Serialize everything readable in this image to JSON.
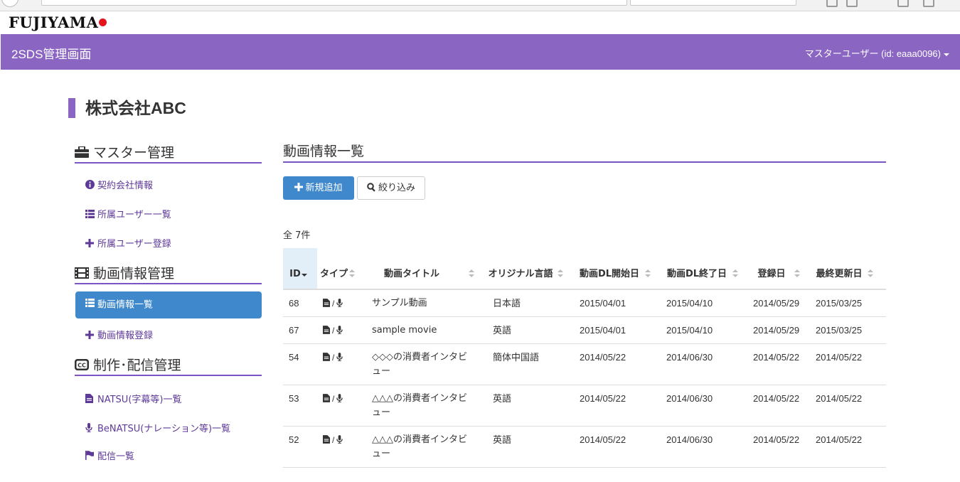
{
  "logo": {
    "text": "FUJIYAMA"
  },
  "navbar": {
    "brand": "2SDS管理画面",
    "user": "マスターユーザー (id: eaaa0096)"
  },
  "company": "株式会社ABC",
  "sidebar": {
    "master": {
      "title": "マスター管理",
      "icon": "briefcase-icon",
      "items": [
        {
          "label": "契約会社情報",
          "icon": "info-circle-icon"
        },
        {
          "label": "所属ユーザー一覧",
          "icon": "list-icon"
        },
        {
          "label": "所属ユーザー登録",
          "icon": "plus-icon"
        }
      ]
    },
    "video": {
      "title": "動画情報管理",
      "icon": "film-icon",
      "items": [
        {
          "label": "動画情報一覧",
          "icon": "list-icon",
          "active": true
        },
        {
          "label": "動画情報登録",
          "icon": "plus-icon"
        }
      ]
    },
    "production": {
      "title": "制作･配信管理",
      "icon": "cc-icon",
      "items": [
        {
          "label": "NATSU(字幕等)一覧",
          "icon": "file-icon"
        },
        {
          "label": "BeNATSU(ナレーション等)一覧",
          "icon": "microphone-icon"
        },
        {
          "label": "配信一覧",
          "icon": "flag-icon"
        }
      ]
    }
  },
  "main": {
    "title": "動画情報一覧",
    "add_button": "新規追加",
    "filter_button": "絞り込み",
    "count": "全 7件",
    "columns": [
      "ID",
      "タイプ",
      "動画タイトル",
      "オリジナル言語",
      "動画DL開始日",
      "動画DL終了日",
      "登録日",
      "最終更新日"
    ],
    "rows": [
      {
        "id": "68",
        "type": "/",
        "title": "サンプル動画",
        "lang": "日本語",
        "dl_start": "2015/04/01",
        "dl_end": "2015/04/10",
        "registered": "2014/05/29",
        "updated": "2015/03/25"
      },
      {
        "id": "67",
        "type": "/",
        "title": "sample movie",
        "lang": "英語",
        "dl_start": "2015/04/01",
        "dl_end": "2015/04/10",
        "registered": "2014/05/29",
        "updated": "2015/03/25"
      },
      {
        "id": "54",
        "type": "/",
        "title": "◇◇◇の消費者インタビュー",
        "lang": "簡体中国語",
        "dl_start": "2014/05/22",
        "dl_end": "2014/06/30",
        "registered": "2014/05/22",
        "updated": "2014/05/22"
      },
      {
        "id": "53",
        "type": "/",
        "title": "△△△の消費者インタビュー",
        "lang": "英語",
        "dl_start": "2014/05/22",
        "dl_end": "2014/06/30",
        "registered": "2014/05/22",
        "updated": "2014/05/22"
      },
      {
        "id": "52",
        "type": "/",
        "title": "△△△の消費者インタビュー",
        "lang": "英語",
        "dl_start": "2014/05/22",
        "dl_end": "2014/06/30",
        "registered": "2014/05/22",
        "updated": "2014/05/22"
      }
    ]
  },
  "colors": {
    "brand_purple": "#8a65c2",
    "active_blue": "#3f88cc",
    "logo_red": "#e4141e"
  }
}
